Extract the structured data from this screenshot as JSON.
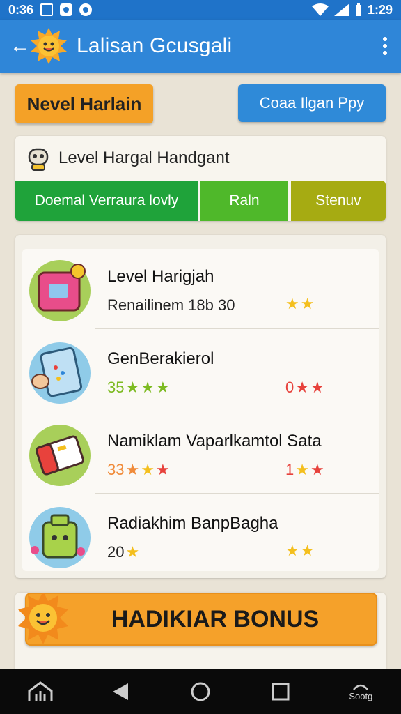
{
  "status_bar": {
    "time_left": "0:36",
    "time_right": "1:29"
  },
  "app_bar": {
    "title": "Lalisan Gcusgali"
  },
  "top_buttons": {
    "primary": "Nevel Harlain",
    "secondary": "Coaa Ilgan Ppy"
  },
  "level_section": {
    "title": "Level Hargal Handgant",
    "tabs": [
      "Doemal Verraura lovly",
      "Raln",
      "Stenuv"
    ],
    "colors": {
      "tab1": "#1fa33a",
      "tab2": "#4fb82a",
      "tab3": "#a6ab12"
    }
  },
  "items": [
    {
      "title": "Level Harigjah",
      "subtitle": "Renailinem 18b 30",
      "left_value": "",
      "left_stars": 0,
      "left_color": "",
      "right_value": "",
      "right_stars": 2,
      "icon": "pink-box-icon"
    },
    {
      "title": "GenBerakierol",
      "subtitle": "",
      "left_value": "35",
      "left_stars": 3,
      "left_color": "green",
      "right_value": "0",
      "right_stars": 2,
      "right_color": "red",
      "icon": "paper-hand-icon"
    },
    {
      "title": "Namiklam Vaparlkamtol Sata",
      "subtitle": "",
      "left_value": "33",
      "left_stars": 3,
      "left_color": "orange",
      "right_value": "1",
      "right_stars": 2,
      "right_color": "red",
      "icon": "book-icon"
    },
    {
      "title": "Radiakhim BanpBagha",
      "subtitle": "",
      "left_value": "20",
      "left_stars": 1,
      "left_color": "dark",
      "right_value": "",
      "right_stars": 2,
      "icon": "robot-bag-icon"
    }
  ],
  "bonus": {
    "label": "HADIKIAR BONUS"
  },
  "nav_bar": {
    "right_label": "Sootg"
  },
  "theme": {
    "app_bar": "#2f86d8",
    "orange": "#f5a12a",
    "star": "#f4bf1d"
  }
}
